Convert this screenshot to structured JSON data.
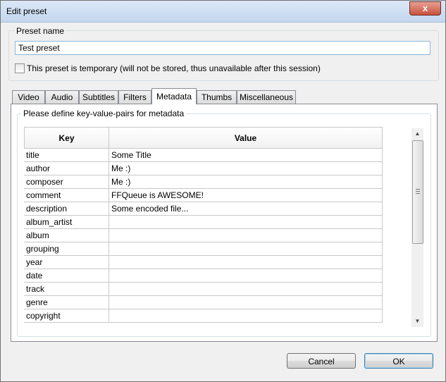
{
  "window": {
    "title": "Edit preset",
    "close_label": "x"
  },
  "preset_name": {
    "label": "Preset name",
    "value": "Test preset"
  },
  "temporary_checkbox": {
    "label": "This preset is temporary (will not be stored, thus unavailable after this session)",
    "checked": false
  },
  "tabs": [
    {
      "label": "Video"
    },
    {
      "label": "Audio"
    },
    {
      "label": "Subtitles"
    },
    {
      "label": "Filters"
    },
    {
      "label": "Metadata",
      "active": true
    },
    {
      "label": "Thumbs"
    },
    {
      "label": "Miscellaneous"
    }
  ],
  "metadata": {
    "group_label": "Please define key-value-pairs for metadata",
    "columns": {
      "key": "Key",
      "value": "Value"
    },
    "rows": [
      {
        "key": "title",
        "value": "Some Title"
      },
      {
        "key": "author",
        "value": "Me :)"
      },
      {
        "key": "composer",
        "value": "Me :)"
      },
      {
        "key": "comment",
        "value": "FFQueue is AWESOME!"
      },
      {
        "key": "description",
        "value": "Some encoded file..."
      },
      {
        "key": "album_artist",
        "value": ""
      },
      {
        "key": "album",
        "value": ""
      },
      {
        "key": "grouping",
        "value": ""
      },
      {
        "key": "year",
        "value": ""
      },
      {
        "key": "date",
        "value": ""
      },
      {
        "key": "track",
        "value": ""
      },
      {
        "key": "genre",
        "value": ""
      },
      {
        "key": "copyright",
        "value": ""
      }
    ]
  },
  "buttons": {
    "cancel": "Cancel",
    "ok": "OK"
  }
}
